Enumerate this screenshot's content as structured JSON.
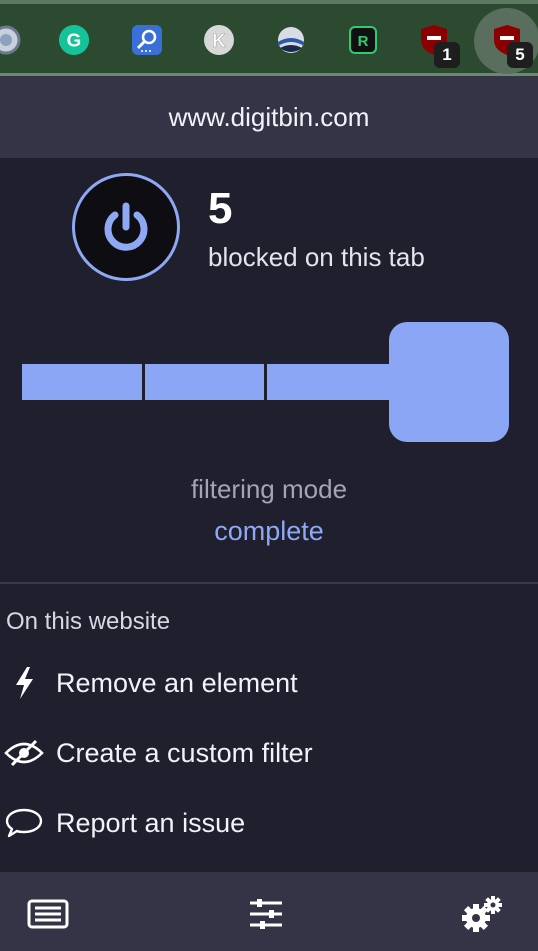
{
  "toolbar": {
    "extensions": [
      {
        "icon": "shield-partial-icon"
      },
      {
        "icon": "grammarly-icon",
        "letter": "G"
      },
      {
        "icon": "search-extension-icon"
      },
      {
        "icon": "k-extension-icon",
        "letter": "K"
      },
      {
        "icon": "sphere-extension-icon"
      },
      {
        "icon": "r-extension-icon",
        "letter": "R"
      },
      {
        "icon": "ublock-icon",
        "badge": "1"
      },
      {
        "icon": "ublock-active-icon",
        "badge": "5"
      }
    ]
  },
  "popup": {
    "hostname": "www.digitbin.com",
    "blocked_count": "5",
    "blocked_label": "blocked on this tab",
    "filtering_mode_label": "filtering mode",
    "filtering_mode_value": "complete",
    "filtering_mode_level": 4,
    "filtering_mode_levels": 4,
    "section_title": "On this website",
    "tools": [
      {
        "icon": "lightning-icon",
        "label": "Remove an element"
      },
      {
        "icon": "eye-slash-icon",
        "label": "Create a custom filter"
      },
      {
        "icon": "speech-bubble-icon",
        "label": "Report an issue"
      }
    ],
    "footer": [
      {
        "icon": "list-icon"
      },
      {
        "icon": "sliders-icon"
      },
      {
        "icon": "gears-icon"
      }
    ]
  },
  "colors": {
    "accent": "#8ea8f4",
    "background": "#1f1f2e",
    "header_bar": "#343446",
    "toolbar": "#2c4a30"
  }
}
